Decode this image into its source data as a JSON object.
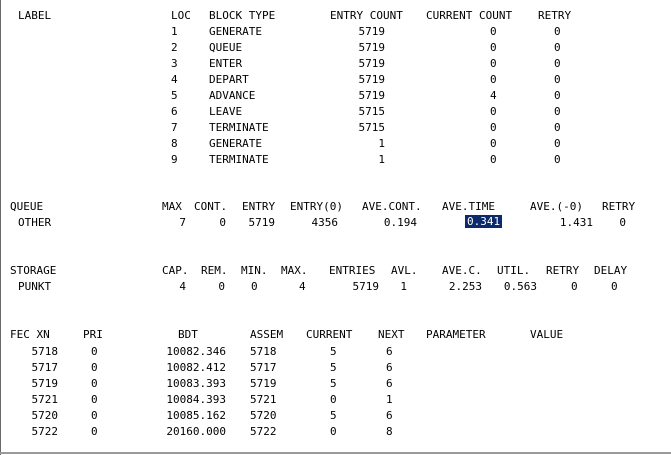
{
  "colors": {
    "background": "#ffffff",
    "text": "#000000",
    "selection": "#0b2a6b",
    "selection_text": "#ffffff"
  },
  "blocks": {
    "headers": [
      "LABEL",
      "LOC",
      "BLOCK TYPE",
      "ENTRY COUNT",
      "CURRENT COUNT",
      "RETRY"
    ],
    "rows": [
      {
        "loc": "1",
        "type": "GENERATE",
        "entry": "5719",
        "current": "0",
        "retry": "0"
      },
      {
        "loc": "2",
        "type": "QUEUE",
        "entry": "5719",
        "current": "0",
        "retry": "0"
      },
      {
        "loc": "3",
        "type": "ENTER",
        "entry": "5719",
        "current": "0",
        "retry": "0"
      },
      {
        "loc": "4",
        "type": "DEPART",
        "entry": "5719",
        "current": "0",
        "retry": "0"
      },
      {
        "loc": "5",
        "type": "ADVANCE",
        "entry": "5719",
        "current": "4",
        "retry": "0"
      },
      {
        "loc": "6",
        "type": "LEAVE",
        "entry": "5715",
        "current": "0",
        "retry": "0"
      },
      {
        "loc": "7",
        "type": "TERMINATE",
        "entry": "5715",
        "current": "0",
        "retry": "0"
      },
      {
        "loc": "8",
        "type": "GENERATE",
        "entry": "1",
        "current": "0",
        "retry": "0"
      },
      {
        "loc": "9",
        "type": "TERMINATE",
        "entry": "1",
        "current": "0",
        "retry": "0"
      }
    ]
  },
  "queue": {
    "headers": [
      "QUEUE",
      "MAX",
      "CONT.",
      "ENTRY",
      "ENTRY(0)",
      "AVE.CONT.",
      "AVE.TIME",
      "AVE.(-0)",
      "RETRY"
    ],
    "row": {
      "name": "OTHER",
      "max": "7",
      "cont": "0",
      "entry": "5719",
      "entry0": "4356",
      "ave_cont": "0.194",
      "ave_time": "0.341",
      "ave_nonzero": "1.431",
      "retry": "0"
    }
  },
  "storage": {
    "headers": [
      "STORAGE",
      "CAP.",
      "REM.",
      "MIN.",
      "MAX.",
      "ENTRIES",
      "AVL.",
      "AVE.C.",
      "UTIL.",
      "RETRY",
      "DELAY"
    ],
    "row": {
      "name": "PUNKT",
      "cap": "4",
      "rem": "0",
      "min": "0",
      "max": "4",
      "entries": "5719",
      "avl": "1",
      "avec": "2.253",
      "util": "0.563",
      "retry": "0",
      "delay": "0"
    }
  },
  "fec": {
    "headers": [
      "FEC XN",
      "PRI",
      "BDT",
      "ASSEM",
      "CURRENT",
      "NEXT",
      "PARAMETER",
      "VALUE"
    ],
    "rows": [
      {
        "xn": "5718",
        "pri": "0",
        "bdt": "10082.346",
        "assem": "5718",
        "current": "5",
        "next": "6"
      },
      {
        "xn": "5717",
        "pri": "0",
        "bdt": "10082.412",
        "assem": "5717",
        "current": "5",
        "next": "6"
      },
      {
        "xn": "5719",
        "pri": "0",
        "bdt": "10083.393",
        "assem": "5719",
        "current": "5",
        "next": "6"
      },
      {
        "xn": "5721",
        "pri": "0",
        "bdt": "10084.393",
        "assem": "5721",
        "current": "0",
        "next": "1"
      },
      {
        "xn": "5720",
        "pri": "0",
        "bdt": "10085.162",
        "assem": "5720",
        "current": "5",
        "next": "6"
      },
      {
        "xn": "5722",
        "pri": "0",
        "bdt": "20160.000",
        "assem": "5722",
        "current": "0",
        "next": "8"
      }
    ]
  }
}
